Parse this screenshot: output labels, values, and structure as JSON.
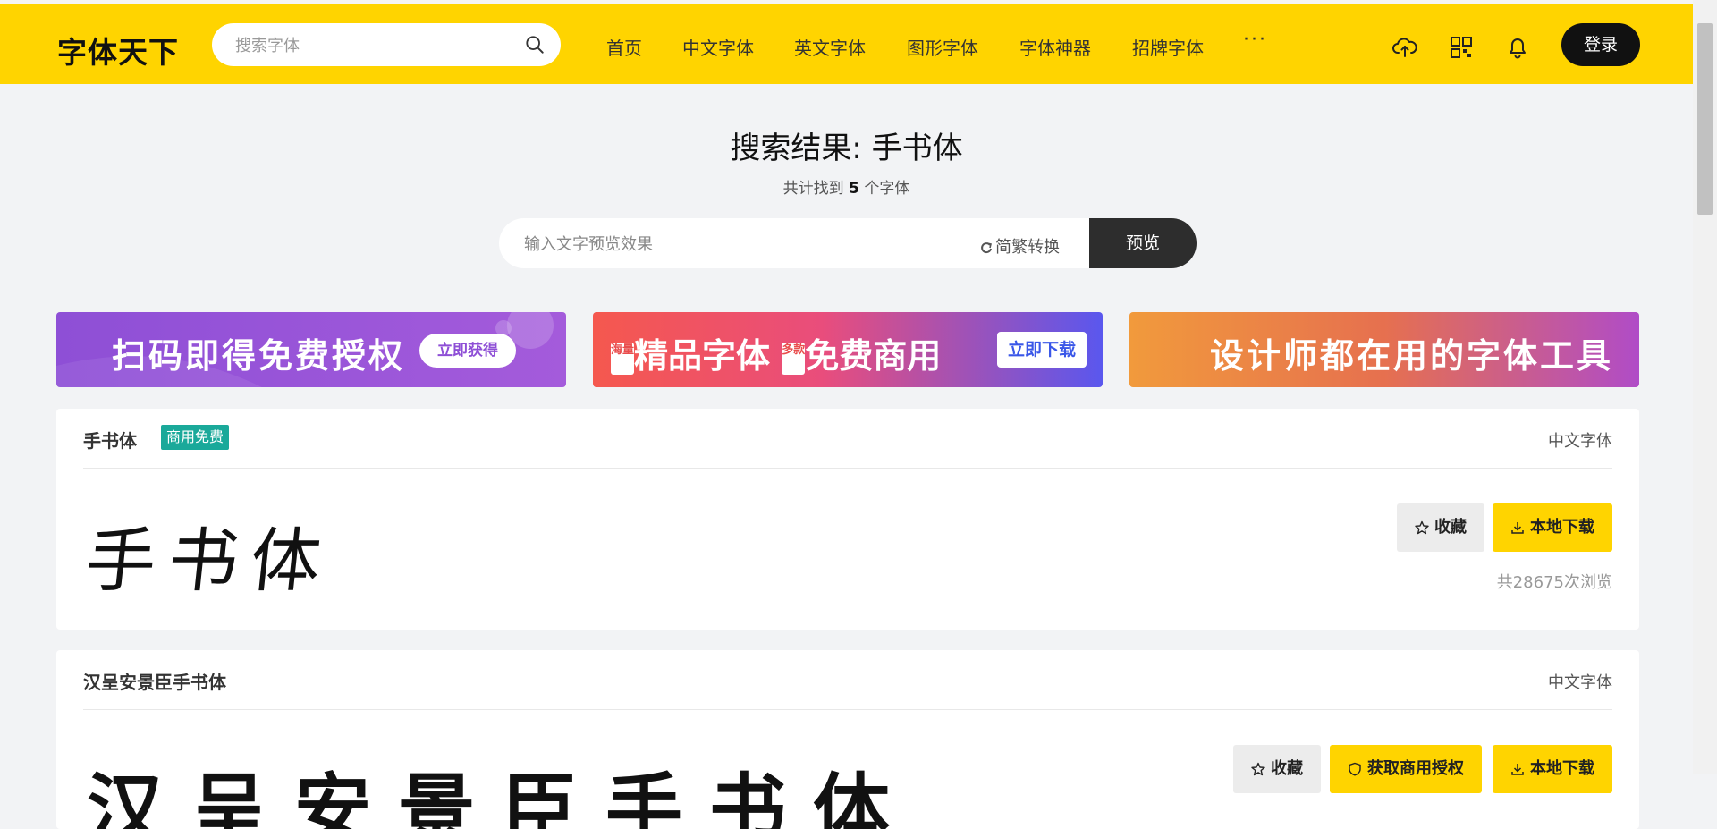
{
  "header": {
    "logo": "字体天下",
    "search_placeholder": "搜索字体",
    "nav": [
      "首页",
      "中文字体",
      "英文字体",
      "图形字体",
      "字体神器",
      "招牌字体"
    ],
    "more": "···",
    "login": "登录"
  },
  "results": {
    "title": "搜索结果: 手书体",
    "count_prefix": "共计找到",
    "count": "5",
    "count_suffix": "个字体"
  },
  "preview": {
    "placeholder": "输入文字预览效果",
    "convert": "简繁转换",
    "button": "预览"
  },
  "banners": [
    {
      "text": "扫码即得免费授权",
      "button": "立即获得"
    },
    {
      "tag1": "海量",
      "text1": "精品字体",
      "tag2": "多款",
      "text2": "免费商用",
      "button": "立即下载"
    },
    {
      "text": "设计师都在用的字体工具"
    }
  ],
  "fonts": [
    {
      "name": "手书体",
      "badge": "商用免费",
      "category": "中文字体",
      "sample": "手书体",
      "fav": "收藏",
      "download": "本地下载",
      "views": "共28675次浏览"
    },
    {
      "name": "汉呈安景臣手书体",
      "category": "中文字体",
      "sample": "汉呈安景臣手书体",
      "fav": "收藏",
      "license": "获取商用授权",
      "download": "本地下载"
    }
  ],
  "colors": {
    "brand": "#ffd400",
    "badge": "#1aa99a",
    "dark": "#2d2d2d"
  }
}
